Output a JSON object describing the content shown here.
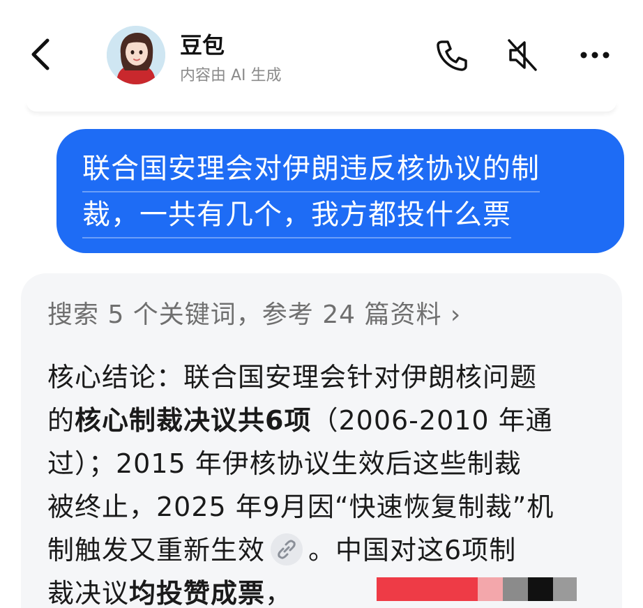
{
  "header": {
    "title": "豆包",
    "subtitle": "内容由 AI 生成"
  },
  "user_message": {
    "lines": [
      "联合国安理会对伊朗违反核协议的制",
      "裁，一共有几个，我方都投什么票"
    ]
  },
  "assistant": {
    "search_summary": "搜索 5 个关键词，参考 24 篇资料 ›",
    "lines": {
      "l1": "核心结论：联合国安理会针对伊朗核问题",
      "l2a": "的",
      "l2b": "核心制裁决议共6项",
      "l2c": "（2006-2010 年通",
      "l3": "过）；2015 年伊核协议生效后这些制裁",
      "l4": "被终止，2025 年9月因“快速恢复制裁”机",
      "l5a": "制触发又重新生效",
      "l5b": "。中国对这6项制",
      "l6a": "裁决议",
      "l6b": "均投赞成票",
      "l6c": "，"
    }
  },
  "colors": {
    "user_bubble": "#1e6cf5",
    "card_bg": "#f5f6f8",
    "redaction": [
      "#ee3b46",
      "#f3a7ab",
      "#8b8b8b",
      "#111111",
      "#9a9a9a"
    ]
  },
  "icons": [
    "back-arrow-icon",
    "phone-icon",
    "mute-speaker-icon",
    "more-icon",
    "link-icon"
  ]
}
